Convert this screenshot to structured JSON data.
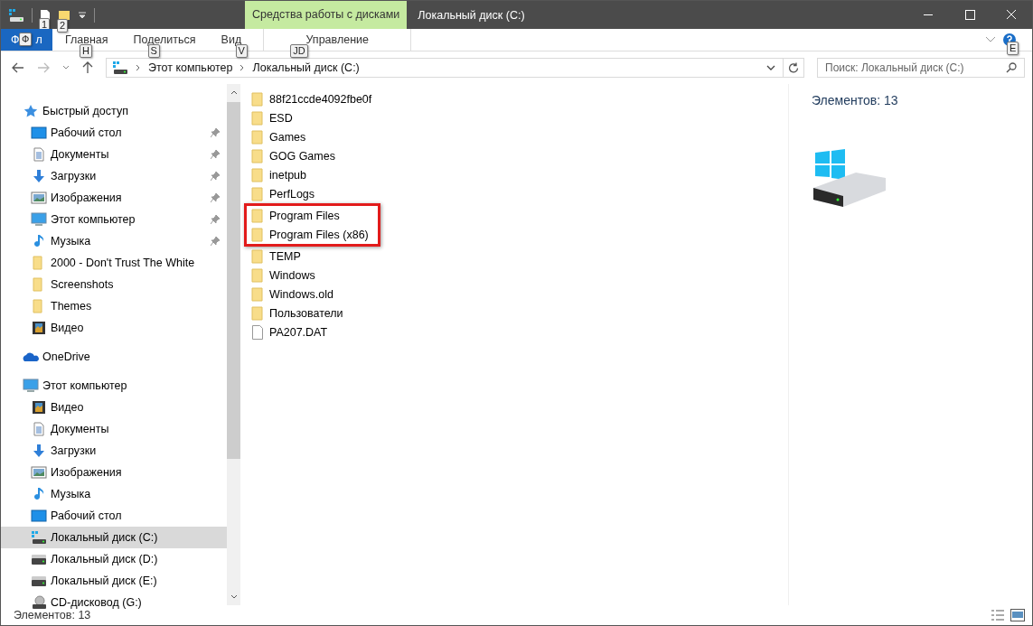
{
  "window": {
    "title": "Локальный диск (C:)",
    "contextual_tab": "Средства работы с дисками"
  },
  "quick_access_toolbar": {
    "keytips": [
      "1",
      "2"
    ]
  },
  "ribbon": {
    "file_tab_parts": [
      "Ф",
      "л"
    ],
    "file_keytip": "Ф",
    "tabs": [
      {
        "label": "Главная",
        "keytip": "H",
        "selected": false
      },
      {
        "label": "Поделиться",
        "keytip": "S",
        "selected": false
      },
      {
        "label": "Вид",
        "keytip": "V",
        "selected": false
      },
      {
        "label": "Управление",
        "keytip": "JD",
        "selected": false
      }
    ],
    "help_keytip": "E"
  },
  "address_bar": {
    "path": [
      "Этот компьютер",
      "Локальный диск (C:)"
    ]
  },
  "search": {
    "placeholder": "Поиск: Локальный диск (C:)"
  },
  "sidebar": {
    "sections": [
      {
        "label": "Быстрый доступ",
        "kind": "star",
        "children": [
          {
            "label": "Рабочий стол",
            "kind": "desktop",
            "pinned": true,
            "selected": false
          },
          {
            "label": "Документы",
            "kind": "documents",
            "pinned": true,
            "selected": false
          },
          {
            "label": "Загрузки",
            "kind": "downloads",
            "pinned": true,
            "selected": false
          },
          {
            "label": "Изображения",
            "kind": "pictures",
            "pinned": true,
            "selected": false
          },
          {
            "label": "Этот компьютер",
            "kind": "computer",
            "pinned": true,
            "selected": false
          },
          {
            "label": "Музыка",
            "kind": "music",
            "pinned": true,
            "selected": false
          },
          {
            "label": "2000 - Don't Trust The White",
            "kind": "folder",
            "pinned": false,
            "selected": false
          },
          {
            "label": "Screenshots",
            "kind": "folder",
            "pinned": false,
            "selected": false
          },
          {
            "label": "Themes",
            "kind": "folder",
            "pinned": false,
            "selected": false
          },
          {
            "label": "Видео",
            "kind": "video",
            "pinned": false,
            "selected": false
          }
        ]
      },
      {
        "label": "OneDrive",
        "kind": "cloud"
      },
      {
        "label": "Этот компьютер",
        "kind": "computer",
        "children": [
          {
            "label": "Видео",
            "kind": "video",
            "pinned": false,
            "selected": false
          },
          {
            "label": "Документы",
            "kind": "documents",
            "pinned": false,
            "selected": false
          },
          {
            "label": "Загрузки",
            "kind": "downloads",
            "pinned": false,
            "selected": false
          },
          {
            "label": "Изображения",
            "kind": "pictures",
            "pinned": false,
            "selected": false
          },
          {
            "label": "Музыка",
            "kind": "music",
            "pinned": false,
            "selected": false
          },
          {
            "label": "Рабочий стол",
            "kind": "desktop",
            "pinned": false,
            "selected": false
          },
          {
            "label": "Локальный диск (C:)",
            "kind": "system-drive",
            "pinned": false,
            "selected": true
          },
          {
            "label": "Локальный диск (D:)",
            "kind": "drive",
            "pinned": false,
            "selected": false
          },
          {
            "label": "Локальный диск (E:)",
            "kind": "drive",
            "pinned": false,
            "selected": false
          },
          {
            "label": "CD-дисковод (G:)",
            "kind": "cd",
            "pinned": false,
            "selected": false
          }
        ]
      }
    ]
  },
  "files": [
    {
      "name": "88f21ccde4092fbe0f",
      "kind": "folder",
      "highlighted": false
    },
    {
      "name": "ESD",
      "kind": "folder",
      "highlighted": false
    },
    {
      "name": "Games",
      "kind": "folder",
      "highlighted": false
    },
    {
      "name": "GOG Games",
      "kind": "folder",
      "highlighted": false
    },
    {
      "name": "inetpub",
      "kind": "folder",
      "highlighted": false
    },
    {
      "name": "PerfLogs",
      "kind": "folder",
      "highlighted": false
    },
    {
      "name": "Program Files",
      "kind": "folder",
      "highlighted": true
    },
    {
      "name": "Program Files (x86)",
      "kind": "folder",
      "highlighted": true
    },
    {
      "name": "TEMP",
      "kind": "folder",
      "highlighted": false
    },
    {
      "name": "Windows",
      "kind": "folder",
      "highlighted": false
    },
    {
      "name": "Windows.old",
      "kind": "folder",
      "highlighted": false
    },
    {
      "name": "Пользователи",
      "kind": "folder",
      "highlighted": false
    },
    {
      "name": "PA207.DAT",
      "kind": "file",
      "highlighted": false
    }
  ],
  "details_pane": {
    "count": "Элементов: 13"
  },
  "status_bar": {
    "count": "Элементов: 13"
  }
}
